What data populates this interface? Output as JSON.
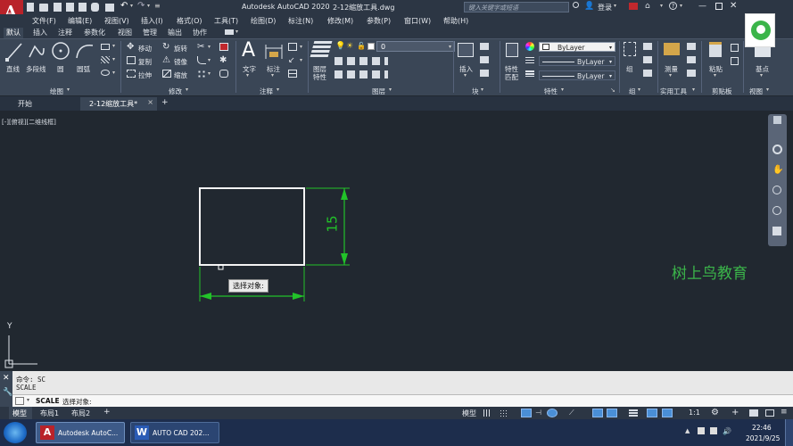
{
  "title_bar": {
    "app_title": "Autodesk AutoCAD 2020",
    "file_title": "2-12缩放工具.dwg",
    "search_placeholder": "键入关键字或短语",
    "sign_in": "登录"
  },
  "menu": [
    "文件(F)",
    "编辑(E)",
    "视图(V)",
    "插入(I)",
    "格式(O)",
    "工具(T)",
    "绘图(D)",
    "标注(N)",
    "修改(M)",
    "参数(P)",
    "窗口(W)",
    "帮助(H)"
  ],
  "ribbon_tabs": [
    "默认",
    "插入",
    "注释",
    "参数化",
    "视图",
    "管理",
    "输出",
    "协作"
  ],
  "ribbon": {
    "draw": {
      "line": "直线",
      "polyline": "多段线",
      "circle": "圆",
      "arc": "圆弧",
      "panel": "绘图"
    },
    "modify": {
      "move": "移动",
      "rotate": "旋转",
      "copy": "复制",
      "mirror": "镜像",
      "stretch": "拉伸",
      "scale": "缩放",
      "panel": "修改"
    },
    "annotation": {
      "text": "文字",
      "dimension": "标注",
      "panel": "注释"
    },
    "layers": {
      "layer_props": "图层",
      "layer_props2": "特性",
      "layer_value": "0",
      "panel": "图层"
    },
    "block": {
      "insert": "插入",
      "panel": "块"
    },
    "properties": {
      "match": "特性",
      "match2": "匹配",
      "color": "ByLayer",
      "linetype": "ByLayer",
      "lineweight": "ByLayer",
      "panel": "特性"
    },
    "groups": {
      "group": "组",
      "panel": "组"
    },
    "utilities": {
      "measure": "测量",
      "panel": "实用工具"
    },
    "clipboard": {
      "paste": "粘贴",
      "panel": "剪贴板"
    },
    "view": {
      "base": "基点",
      "panel": "视图"
    }
  },
  "doc_tabs": {
    "start": "开始",
    "file": "2-12缩放工具*",
    "add": "+"
  },
  "viewport_label": "[-][俯视][二维线框]",
  "drawing": {
    "dimension_text": "15",
    "tooltip": "选择对象:",
    "watermark": "树上鸟教育",
    "axis_y": "Y"
  },
  "command": {
    "line1": "命令: SC",
    "line2": "SCALE",
    "prompt_cmd": "SCALE",
    "prompt_text": "选择对象:"
  },
  "layout_tabs": [
    "模型",
    "布局1",
    "布局2"
  ],
  "status": {
    "model": "模型",
    "scale": "1:1"
  },
  "taskbar": {
    "app1": "Autodesk AutoC...",
    "app2": "AUTO  CAD 202...",
    "time": "22:46",
    "date": "2021/9/25"
  },
  "colors": {
    "accent": "#c0282d",
    "canvas": "#212830",
    "dimension": "#22c229",
    "watermark": "#3bb54a"
  }
}
